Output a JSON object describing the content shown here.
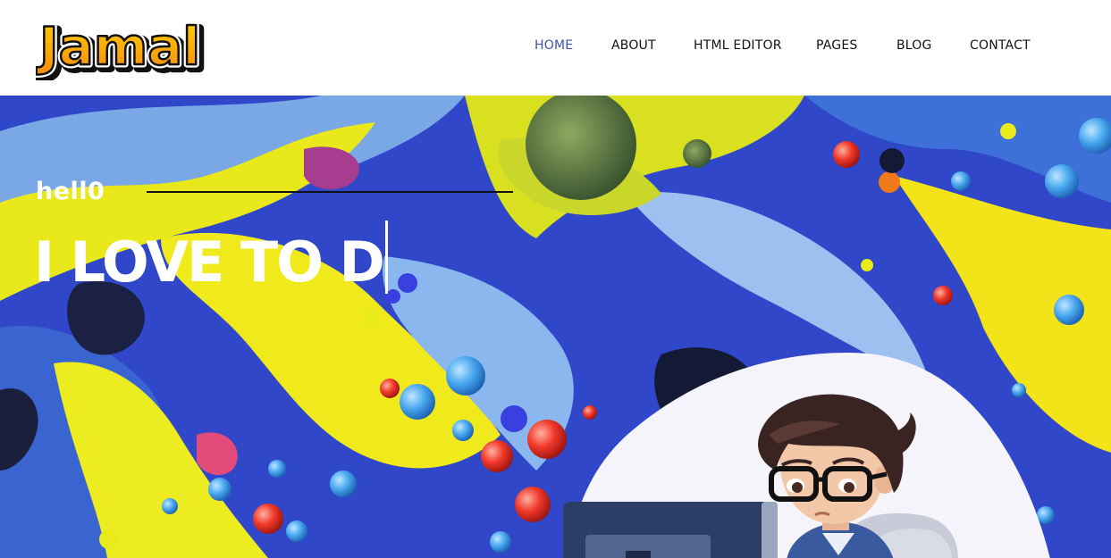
{
  "header": {
    "logo_text": "Jamal",
    "nav": [
      {
        "label": "HOME",
        "active": true
      },
      {
        "label": "ABOUT",
        "active": false
      },
      {
        "label": "HTML EDITOR",
        "active": false
      },
      {
        "label": "PAGES",
        "active": false
      },
      {
        "label": "BLOG",
        "active": false
      },
      {
        "label": "CONTACT",
        "active": false
      }
    ]
  },
  "hero": {
    "greeting": "hell0",
    "headline": "I LOVE TO D"
  },
  "colors": {
    "accent": "#3f51b5",
    "text": "#111111",
    "logo_orange": "#f7a21b",
    "logo_yellow": "#ffd200"
  }
}
